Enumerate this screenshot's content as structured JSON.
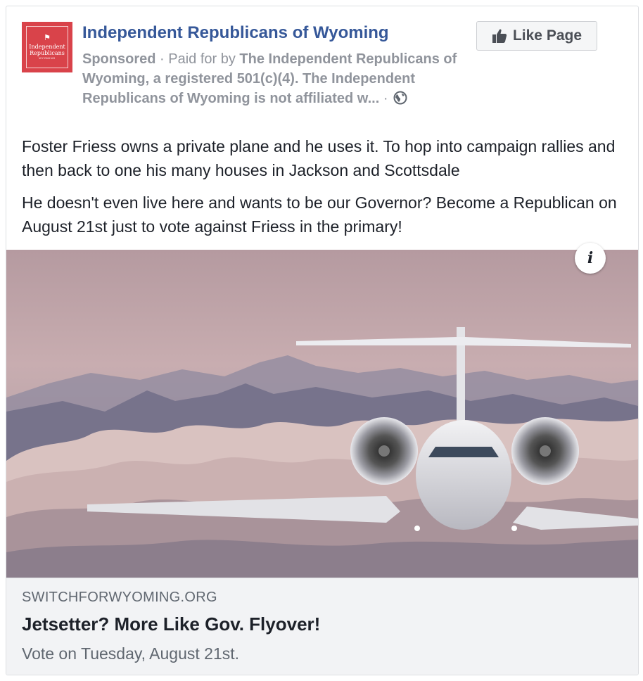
{
  "page": {
    "name": "Independent Republicans of Wyoming",
    "logo_text": [
      "Independent",
      "Republicans",
      "WYOMING"
    ]
  },
  "like_button": {
    "label": "Like Page",
    "icon": "thumbs-up-icon"
  },
  "meta": {
    "sponsored": "Sponsored",
    "separator": " · ",
    "paid_for_prefix": "Paid for by ",
    "paid_for_text": "The Independent Republicans of Wyoming, a registered 501(c)(4). The Independent Republicans of Wyoming is not affiliated w...",
    "trailing_separator": " · ",
    "audience_icon": "globe-icon"
  },
  "post": {
    "paragraphs": [
      "Foster Friess owns a private plane and he uses it. To hop into campaign rallies and then back to one his many houses in Jackson and Scottsdale",
      "He doesn't even live here and wants to be our Governor? Become a Republican on August 21st just to vote against Friess in the primary!"
    ]
  },
  "image": {
    "description_icon": "info-icon",
    "info_label": "i"
  },
  "link": {
    "domain": "SWITCHFORWYOMING.ORG",
    "headline": "Jetsetter? More Like Gov. Flyover!",
    "description": "Vote on Tuesday, August 21st."
  },
  "colors": {
    "brand_red": "#d9434a",
    "page_name_blue": "#365899",
    "meta_gray": "#90949c",
    "link_bg": "#f2f3f5"
  }
}
